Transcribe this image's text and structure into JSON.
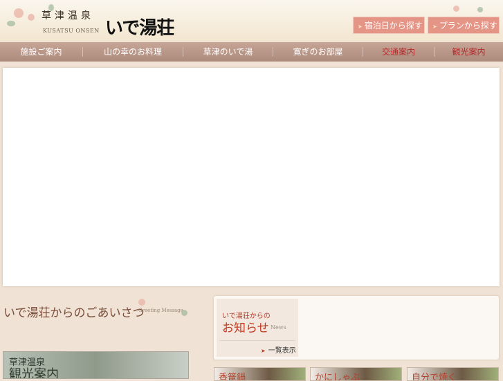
{
  "header": {
    "logo_sub": "草津温泉",
    "logo_en": "KUSATSU ONSEN",
    "logo_main": "いで湯荘",
    "buttons": [
      {
        "label": "宿泊日から探す"
      },
      {
        "label": "プランから探す"
      }
    ]
  },
  "nav": {
    "items": [
      {
        "label": "施設ご案内"
      },
      {
        "label": "山の幸のお料理"
      },
      {
        "label": "草津のいで湯"
      },
      {
        "label": "寛ぎのお部屋"
      },
      {
        "label": "交通案内"
      },
      {
        "label": "観光案内"
      }
    ]
  },
  "greeting": {
    "title": "いで湯荘からのごあいさつ",
    "subtitle": "Greeting Message"
  },
  "news": {
    "small": "いで湯荘からの",
    "title": "お知らせ",
    "en": "News",
    "list_link": "一覧表示"
  },
  "tour": {
    "line1": "草津温泉",
    "line2": "観光案内"
  },
  "cards": [
    {
      "label": "香篭鍋"
    },
    {
      "label": "かにしゃぶ"
    },
    {
      "label": "自分で焼く"
    }
  ]
}
